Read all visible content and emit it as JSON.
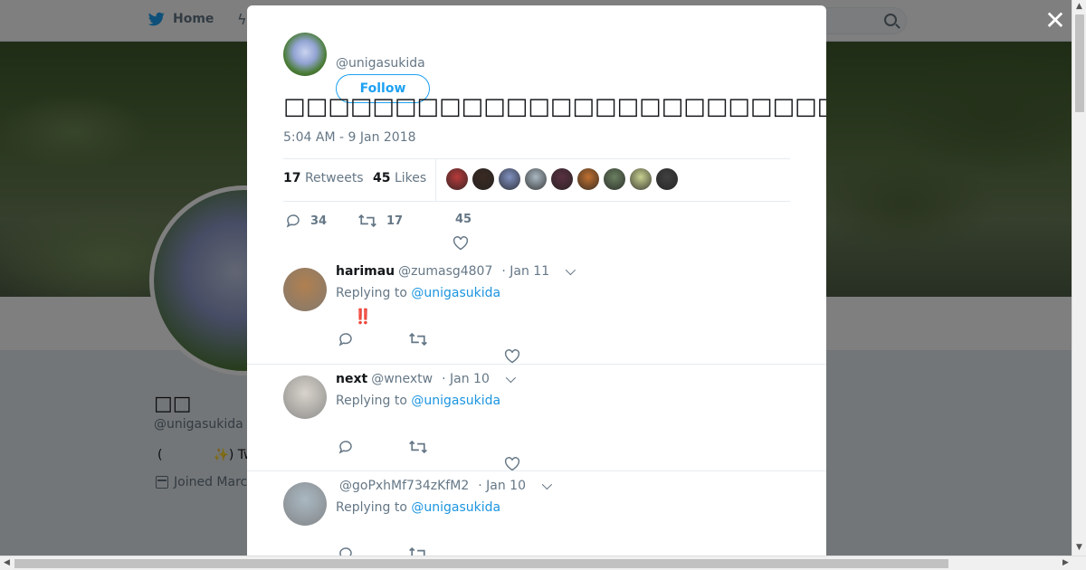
{
  "nav": {
    "home_label": "Home"
  },
  "profile": {
    "name": "□□",
    "handle": "@unigasukida",
    "bio": "(　　　　✨) Twi",
    "joined": "Joined Marc"
  },
  "tweet": {
    "handle": "@unigasukida",
    "follow_label": "Follow",
    "text": "□□□□□□□□□□□□□□□□□□□□□□□□□□□□□□□□□□□□□□□□□□□",
    "timestamp": "5:04 AM - 9 Jan 2018",
    "retweets_count": "17",
    "retweets_label": "Retweets",
    "likes_count": "45",
    "likes_label": "Likes",
    "reply_count": "34",
    "retweet_action_count": "17",
    "like_action_count": "45",
    "liker_colors": [
      "#b83a3a",
      "#3a2a22",
      "#8090c0",
      "#aab8c2",
      "#5a3040",
      "#c07030",
      "#6a8060",
      "#c8d090",
      "#404040"
    ]
  },
  "replies": [
    {
      "name": "harimau",
      "handle": "@zumasg4807",
      "date": "· Jan 11",
      "replying_prefix": "Replying to",
      "replying_to": "@unigasukida",
      "body": "‼️",
      "avatar_color": "#b08050"
    },
    {
      "name": "next",
      "handle": "@wnextw",
      "date": "· Jan 10",
      "replying_prefix": "Replying to",
      "replying_to": "@unigasukida",
      "body": "",
      "avatar_color": "#d8d4cc"
    },
    {
      "name": "",
      "handle": "@goPxhMf734zKfM2",
      "date": "· Jan 10",
      "replying_prefix": "Replying to",
      "replying_to": "@unigasukida",
      "body": "",
      "avatar_color": "#aab8c2"
    }
  ]
}
